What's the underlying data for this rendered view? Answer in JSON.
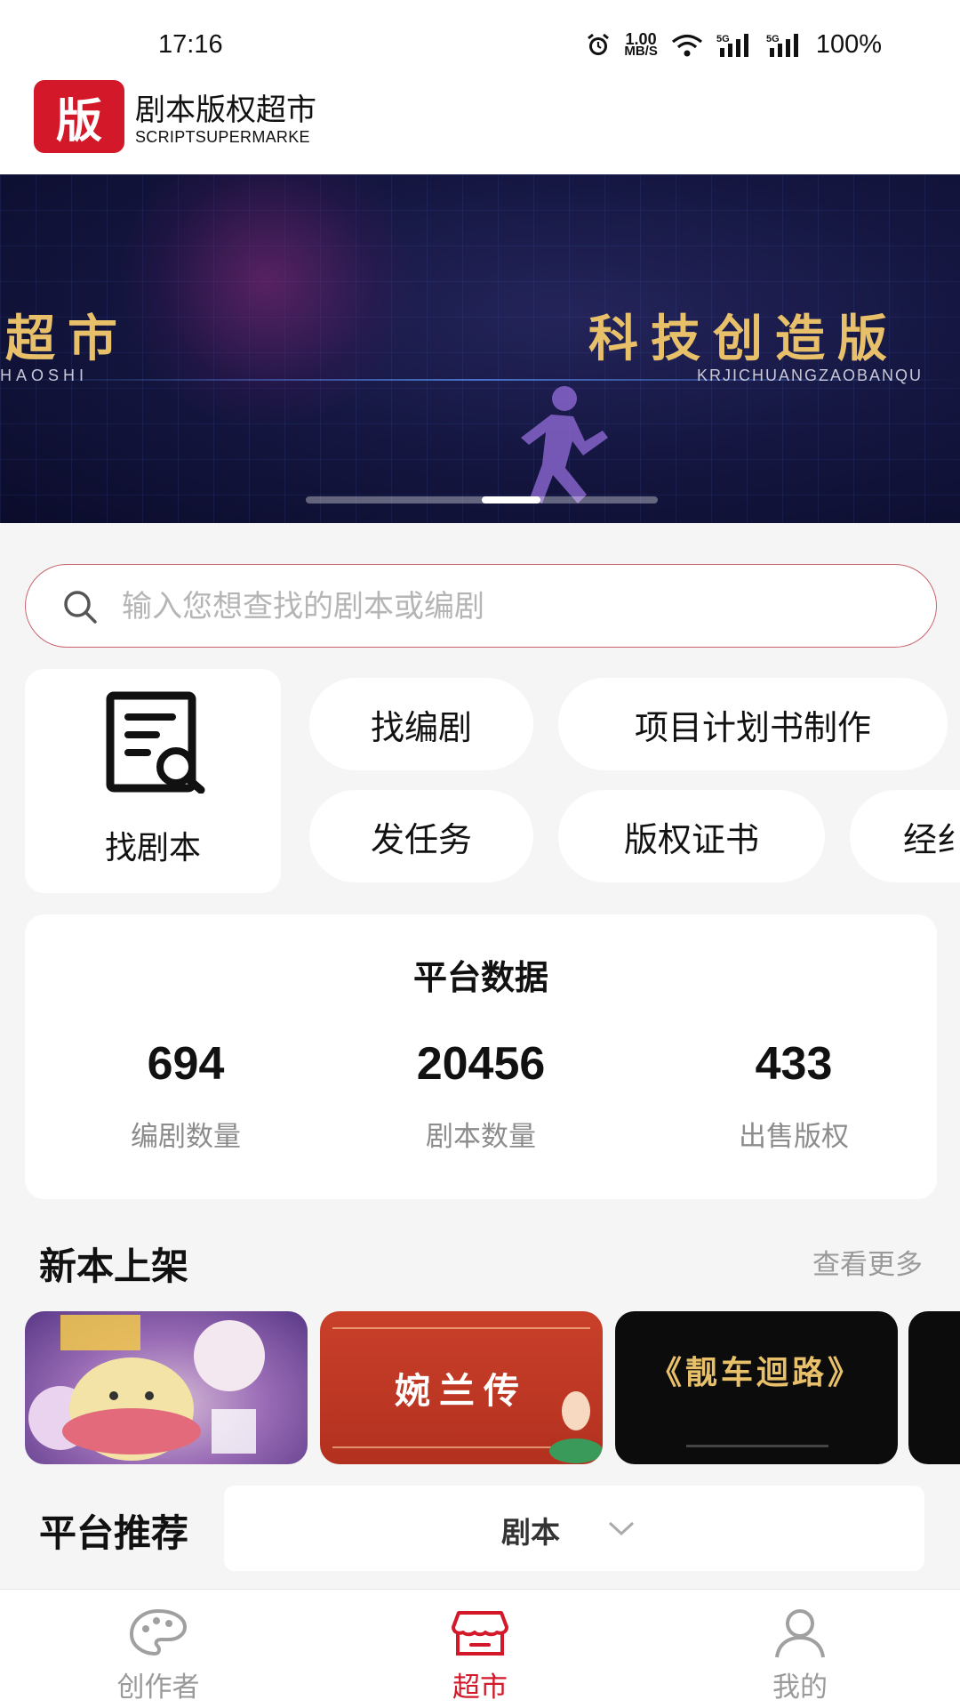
{
  "status_bar": {
    "time": "17:16",
    "net_speed_value": "1.00",
    "net_speed_unit": "MB/S",
    "battery": "100%",
    "icons": [
      "alarm-icon",
      "wifi-icon",
      "signal-5g-icon",
      "signal-5g-icon"
    ]
  },
  "header": {
    "logo_char": "版",
    "app_name": "剧本版权超市",
    "app_subtitle": "SCRIPTSUPERMARKE"
  },
  "banner": {
    "left_text": "超市",
    "left_sub": "HAOSHI",
    "right_text": "科技创造版",
    "right_sub": "KRJICHUANGZAOBANQU",
    "slide_count": 5,
    "active_slide": 3
  },
  "search": {
    "placeholder": "输入您想查找的剧本或编剧"
  },
  "quick_actions": {
    "find_script": "找剧本",
    "find_writer": "找编剧",
    "project_plan": "项目计划书制作",
    "post_task": "发任务",
    "copyright_cert": "版权证书",
    "more_partial": "经纟"
  },
  "platform_data": {
    "title": "平台数据",
    "stats": [
      {
        "value": "694",
        "label": "编剧数量"
      },
      {
        "value": "20456",
        "label": "剧本数量"
      },
      {
        "value": "433",
        "label": "出售版权"
      }
    ]
  },
  "new_arrivals": {
    "title": "新本上架",
    "more": "查看更多",
    "items": [
      {
        "text": ""
      },
      {
        "text": "婉兰传"
      },
      {
        "text": "《靓车迴路》"
      },
      {
        "text": ""
      }
    ]
  },
  "recommend": {
    "title": "平台推荐",
    "filter": "剧本"
  },
  "bottom_nav": {
    "items": [
      {
        "label": "创作者",
        "icon": "palette-icon"
      },
      {
        "label": "超市",
        "icon": "store-icon"
      },
      {
        "label": "我的",
        "icon": "user-icon"
      }
    ],
    "active": "超市"
  },
  "colors": {
    "brand": "#d3182a",
    "background": "#f5f5f6",
    "muted_text": "#9a9a9a",
    "banner_gold": "#e8c06a"
  }
}
